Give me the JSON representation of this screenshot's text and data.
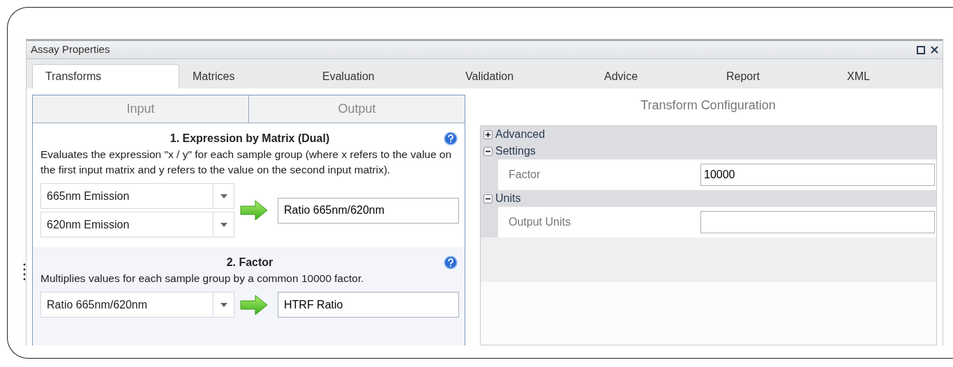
{
  "window": {
    "title": "Assay Properties"
  },
  "tabs": [
    {
      "label": "Transforms",
      "selected": true
    },
    {
      "label": "Matrices",
      "selected": false
    },
    {
      "label": "Evaluation",
      "selected": false
    },
    {
      "label": "Validation",
      "selected": false
    },
    {
      "label": "Advice",
      "selected": false
    },
    {
      "label": "Report",
      "selected": false
    },
    {
      "label": "XML",
      "selected": false
    }
  ],
  "io_tabs": [
    {
      "label": "Input",
      "selected": false
    },
    {
      "label": "Output",
      "selected": false
    }
  ],
  "transforms": [
    {
      "title": "1. Expression by Matrix (Dual)",
      "description": "Evaluates the expression \"x / y\" for each sample group (where x refers to the value on the first input matrix and y refers to the value on the second input matrix).",
      "inputs": [
        "665nm Emission",
        "620nm Emission"
      ],
      "output": "Ratio 665nm/620nm"
    },
    {
      "title": "2. Factor",
      "description": "Multiplies values for each sample group by a common 10000 factor.",
      "inputs": [
        "Ratio 665nm/620nm"
      ],
      "output": "HTRF Ratio"
    }
  ],
  "configuration": {
    "title": "Transform Configuration",
    "categories": [
      {
        "label": "Advanced",
        "expanded": false
      },
      {
        "label": "Settings",
        "expanded": true,
        "properties": [
          {
            "label": "Factor",
            "value": "10000"
          }
        ]
      },
      {
        "label": "Units",
        "expanded": true,
        "properties": [
          {
            "label": "Output Units"
          }
        ]
      }
    ]
  }
}
